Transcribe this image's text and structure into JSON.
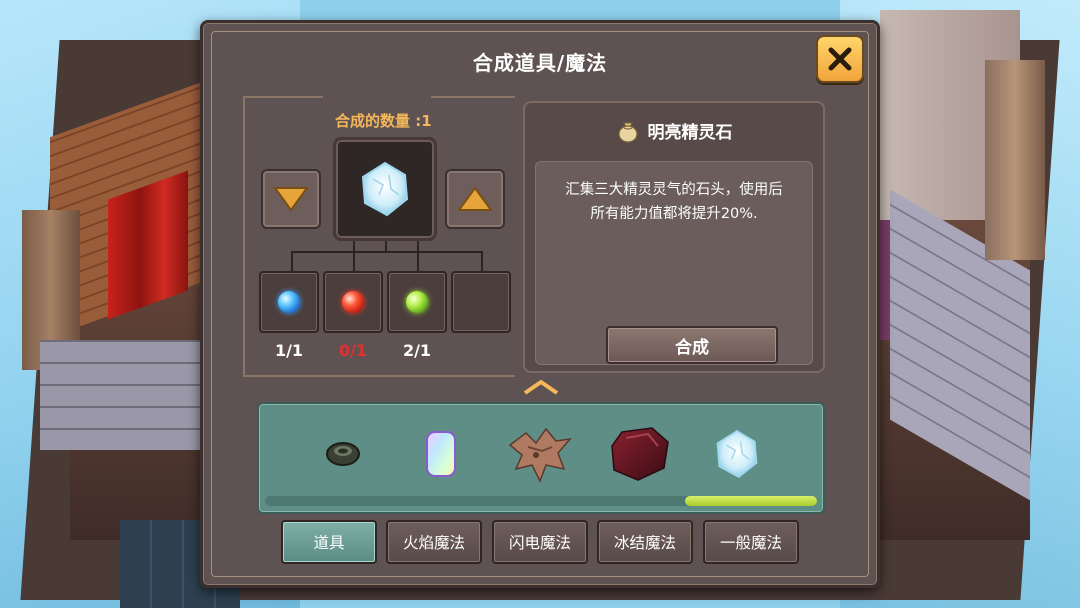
{
  "dialog": {
    "title": "合成道具/魔法",
    "close_icon": "close-x-icon"
  },
  "craft": {
    "quantity_label": "合成的数量 :1",
    "decrease_icon": "triangle-down-icon",
    "increase_icon": "triangle-up-icon",
    "result_icon": "ice-crystal-icon",
    "ingredients": [
      {
        "icon": "blue-orb-icon",
        "color": "#39a7ff",
        "count": "1/1",
        "sufficient": true
      },
      {
        "icon": "red-orb-icon",
        "color": "#ff3b2a",
        "count": "0/1",
        "sufficient": false
      },
      {
        "icon": "green-orb-icon",
        "color": "#9be030",
        "count": "2/1",
        "sufficient": true
      },
      {
        "icon": "empty-slot",
        "count": ""
      }
    ]
  },
  "item": {
    "icon": "pouch-icon",
    "name": "明亮精灵石",
    "description_line1": "汇集三大精灵灵气的石头，使用后",
    "description_line2": "所有能力值都将提升20%.",
    "craft_button": "合成"
  },
  "inventory": {
    "expand_icon": "chevron-up-icon",
    "items": [
      {
        "icon": "dark-ring-icon"
      },
      {
        "icon": "rainbow-crystal-icon"
      },
      {
        "icon": "dragon-fragment-icon"
      },
      {
        "icon": "dark-red-stone-icon"
      },
      {
        "icon": "ice-crystal-icon"
      }
    ],
    "scroll_position": 1.0
  },
  "tabs": [
    {
      "label": "道具",
      "active": true
    },
    {
      "label": "火焰魔法",
      "active": false
    },
    {
      "label": "闪电魔法",
      "active": false
    },
    {
      "label": "冰结魔法",
      "active": false
    },
    {
      "label": "一般魔法",
      "active": false
    }
  ],
  "colors": {
    "panel": "#5e5252",
    "accent_orange": "#f4b85a",
    "tab_active": "#6a9e96",
    "insufficient": "#e03030",
    "scroll_thumb": "#c6e24a"
  }
}
